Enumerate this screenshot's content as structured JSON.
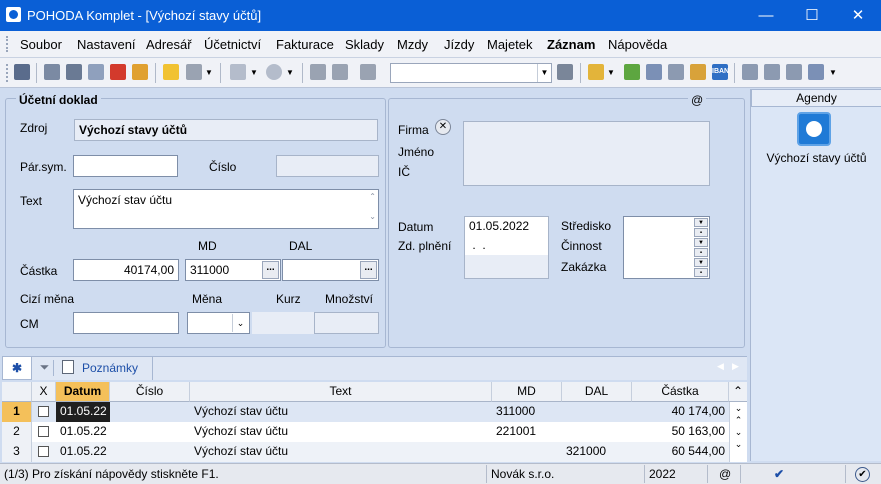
{
  "window": {
    "title": "POHODA Komplet - [Výchozí stavy účtů]",
    "minimize": "—",
    "maximize": "☐",
    "close": "✕"
  },
  "menu": [
    "Soubor",
    "Nastavení",
    "Adresář",
    "Účetnictví",
    "Fakturace",
    "Sklady",
    "Mzdy",
    "Jízdy",
    "Majetek",
    "Záznam",
    "Nápověda"
  ],
  "toolbar": {
    "iban_label": "IBAN"
  },
  "form": {
    "group_title": "Účetní doklad",
    "at_sign": "@",
    "zdroj_label": "Zdroj",
    "zdroj_value": "Výchozí stavy účtů",
    "parsym_label": "Pár.sym.",
    "parsym_value": "",
    "cislo_label": "Číslo",
    "cislo_value": "",
    "text_label": "Text",
    "text_value": "Výchozí stav účtu",
    "md_header": "MD",
    "dal_header": "DAL",
    "castka_label": "Částka",
    "castka_value": "40174,00",
    "md_value": "311000",
    "dal_value": "",
    "cizi_mena_label": "Cizí měna",
    "mena_label": "Měna",
    "kurz_label": "Kurz",
    "mnozstvi_label": "Množství",
    "cm_label": "CM",
    "cm_value": "",
    "firma_label": "Firma",
    "jmeno_label": "Jméno",
    "ic_label": "IČ",
    "datum_label": "Datum",
    "datum_value": "01.05.2022",
    "zd_plneni_label": "Zd. plnění",
    "zd_plneni_value": " .  .",
    "stredisko_label": "Středisko",
    "cinnost_label": "Činnost",
    "zakazka_label": "Zakázka",
    "dots": "..."
  },
  "agenda": {
    "title": "Agendy",
    "item": "Výchozí stavy účtů"
  },
  "tabs": {
    "star": "✱",
    "notes": "Poznámky"
  },
  "table": {
    "headers": [
      "X",
      "Datum",
      "Číslo",
      "Text",
      "MD",
      "DAL",
      "Částka"
    ],
    "rows": [
      {
        "n": "1",
        "datum": "01.05.22",
        "cislo": "",
        "text": "Výchozí stav účtu",
        "md": "311000",
        "dal": "",
        "castka": "40 174,00"
      },
      {
        "n": "2",
        "datum": "01.05.22",
        "cislo": "",
        "text": "Výchozí stav účtu",
        "md": "221001",
        "dal": "",
        "castka": "50 163,00"
      },
      {
        "n": "3",
        "datum": "01.05.22",
        "cislo": "",
        "text": "Výchozí stav účtu",
        "md": "",
        "dal": "321000",
        "castka": "60 544,00"
      }
    ]
  },
  "status": {
    "help": "(1/3) Pro získání nápovědy stiskněte F1.",
    "company": "Novák s.r.o.",
    "year": "2022",
    "at": "@"
  }
}
